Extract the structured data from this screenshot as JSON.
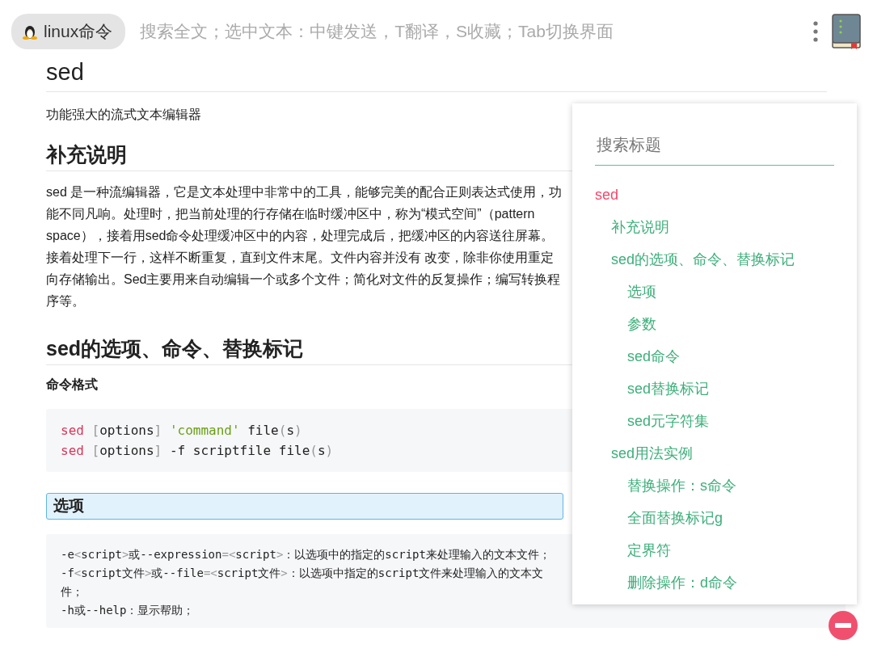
{
  "topbar": {
    "tag": "linux命令",
    "search": {
      "placeholder": "搜索全文；选中文本：中键发送，T翻译，S收藏；Tab切换界面"
    }
  },
  "article": {
    "title": "sed",
    "subtitle": "功能强大的流式文本编辑器",
    "sections": [
      {
        "heading": "补充说明",
        "highlighted": false,
        "blocks": [
          {
            "kind": "paragraph",
            "text": "sed 是一种流编辑器，它是文本处理中非常中的工具，能够完美的配合正则表达式使用，功能不同凡响。处理时，把当前处理的行存储在临时缓冲区中，称为“模式空间”（pattern space），接着用sed命令处理缓冲区中的内容，处理完成后，把缓冲区的内容送往屏幕。接着处理下一行，这样不断重复，直到文件末尾。文件内容并没有 改变，除非你使用重定向存储输出。Sed主要用来自动编辑一个或多个文件；简化对文件的反复操作；编写转换程序等。"
          }
        ]
      },
      {
        "heading": "sed的选项、命令、替换标记",
        "highlighted": false,
        "blocks": [
          {
            "kind": "label",
            "text": "命令格式"
          },
          {
            "kind": "code",
            "lines": [
              [
                {
                  "kind": "keyword",
                  "text": "sed"
                },
                {
                  "kind": "punct",
                  "text": " ["
                },
                {
                  "kind": "plain",
                  "text": "options"
                },
                {
                  "kind": "punct",
                  "text": "] "
                },
                {
                  "kind": "string",
                  "text": "'command'"
                },
                {
                  "kind": "plain",
                  "text": " file"
                },
                {
                  "kind": "punct",
                  "text": "("
                },
                {
                  "kind": "plain",
                  "text": "s"
                },
                {
                  "kind": "punct",
                  "text": ")"
                }
              ],
              [
                {
                  "kind": "keyword",
                  "text": "sed"
                },
                {
                  "kind": "punct",
                  "text": " ["
                },
                {
                  "kind": "plain",
                  "text": "options"
                },
                {
                  "kind": "punct",
                  "text": "]"
                },
                {
                  "kind": "plain",
                  "text": " -f scriptfile file"
                },
                {
                  "kind": "punct",
                  "text": "("
                },
                {
                  "kind": "plain",
                  "text": "s"
                },
                {
                  "kind": "punct",
                  "text": ")"
                }
              ]
            ]
          }
        ]
      },
      {
        "heading": "选项",
        "highlighted": true,
        "blocks": [
          {
            "kind": "code",
            "lines": [
              [
                {
                  "kind": "plain",
                  "text": "-e"
                },
                {
                  "kind": "punct",
                  "text": "<"
                },
                {
                  "kind": "plain",
                  "text": "script"
                },
                {
                  "kind": "punct",
                  "text": ">"
                },
                {
                  "kind": "plain",
                  "text": "或--expression"
                },
                {
                  "kind": "punct",
                  "text": "=<"
                },
                {
                  "kind": "plain",
                  "text": "script"
                },
                {
                  "kind": "punct",
                  "text": ">"
                },
                {
                  "kind": "plain",
                  "text": "：以选项中的指定的script来处理输入的文本文件；"
                }
              ],
              [
                {
                  "kind": "plain",
                  "text": "-f"
                },
                {
                  "kind": "punct",
                  "text": "<"
                },
                {
                  "kind": "plain",
                  "text": "script文件"
                },
                {
                  "kind": "punct",
                  "text": ">"
                },
                {
                  "kind": "plain",
                  "text": "或--file"
                },
                {
                  "kind": "punct",
                  "text": "=<"
                },
                {
                  "kind": "plain",
                  "text": "script文件"
                },
                {
                  "kind": "punct",
                  "text": ">"
                },
                {
                  "kind": "plain",
                  "text": "：以选项中指定的script文件来处理输入的文本文件；"
                }
              ],
              [
                {
                  "kind": "plain",
                  "text": "-h或--help：显示帮助；"
                }
              ]
            ]
          }
        ]
      }
    ]
  },
  "toc": {
    "search": {
      "placeholder": "搜索标题"
    },
    "items": [
      {
        "label": "sed",
        "selected": true,
        "children": [
          {
            "label": "补充说明",
            "selected": false
          },
          {
            "label": "sed的选项、命令、替换标记",
            "selected": false,
            "children": [
              {
                "label": "选项",
                "selected": false
              },
              {
                "label": "参数",
                "selected": false
              },
              {
                "label": "sed命令",
                "selected": false
              },
              {
                "label": "sed替换标记",
                "selected": false
              },
              {
                "label": "sed元字符集",
                "selected": false
              }
            ]
          },
          {
            "label": "sed用法实例",
            "selected": false,
            "children": [
              {
                "label": "替换操作：s命令",
                "selected": false
              },
              {
                "label": "全面替换标记g",
                "selected": false
              },
              {
                "label": "定界符",
                "selected": false
              },
              {
                "label": "删除操作：d命令",
                "selected": false
              }
            ]
          }
        ]
      }
    ]
  }
}
